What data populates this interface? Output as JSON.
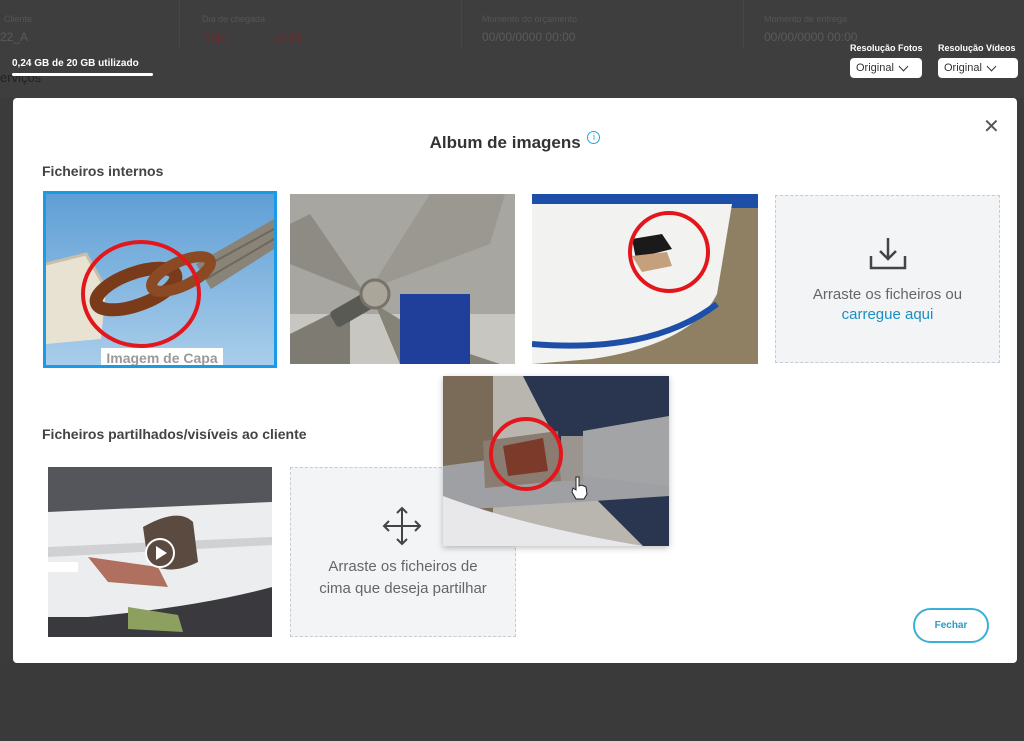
{
  "background": {
    "cells": [
      {
        "label": "Cliente",
        "value": "22_A"
      },
      {
        "label": "Dia de chegada",
        "value": "Hoje",
        "value2": "19:13"
      },
      {
        "label": "Momento do orçamento",
        "value": "00/00/0000 00:00"
      },
      {
        "label": "Momento de entrega",
        "value": "00/00/0000 00:00"
      }
    ],
    "left_fragment": "erviços",
    "storage_text": "0,24 GB de 20 GB utilizado",
    "photo_res_label": "Resolução Fotos",
    "photo_res_value": "Original",
    "video_res_label": "Resolução Vídeos",
    "video_res_value": "Original"
  },
  "modal": {
    "title": "Album de imagens",
    "info_glyph": "i",
    "close_glyph": "✕",
    "internal_section_title": "Ficheiros internos",
    "cover_label": "Imagem de Capa",
    "upload_text": "Arraste os ficheiros ou",
    "upload_link": "carregue aqui",
    "shared_section_title": "Ficheiros partilhados/visíveis ao cliente",
    "share_drop_text_line1": "Arraste os ficheiros de",
    "share_drop_text_line2": "cima que deseja partilhar",
    "close_button": "Fechar"
  },
  "icons": {
    "upload": "download-tray-icon",
    "move": "move-arrows-icon",
    "play": "play-icon",
    "cursor": "hand-cursor-icon"
  },
  "colors": {
    "accent": "#1a9be6",
    "annotation_circle": "#e3161b",
    "link": "#1a8fc4"
  }
}
